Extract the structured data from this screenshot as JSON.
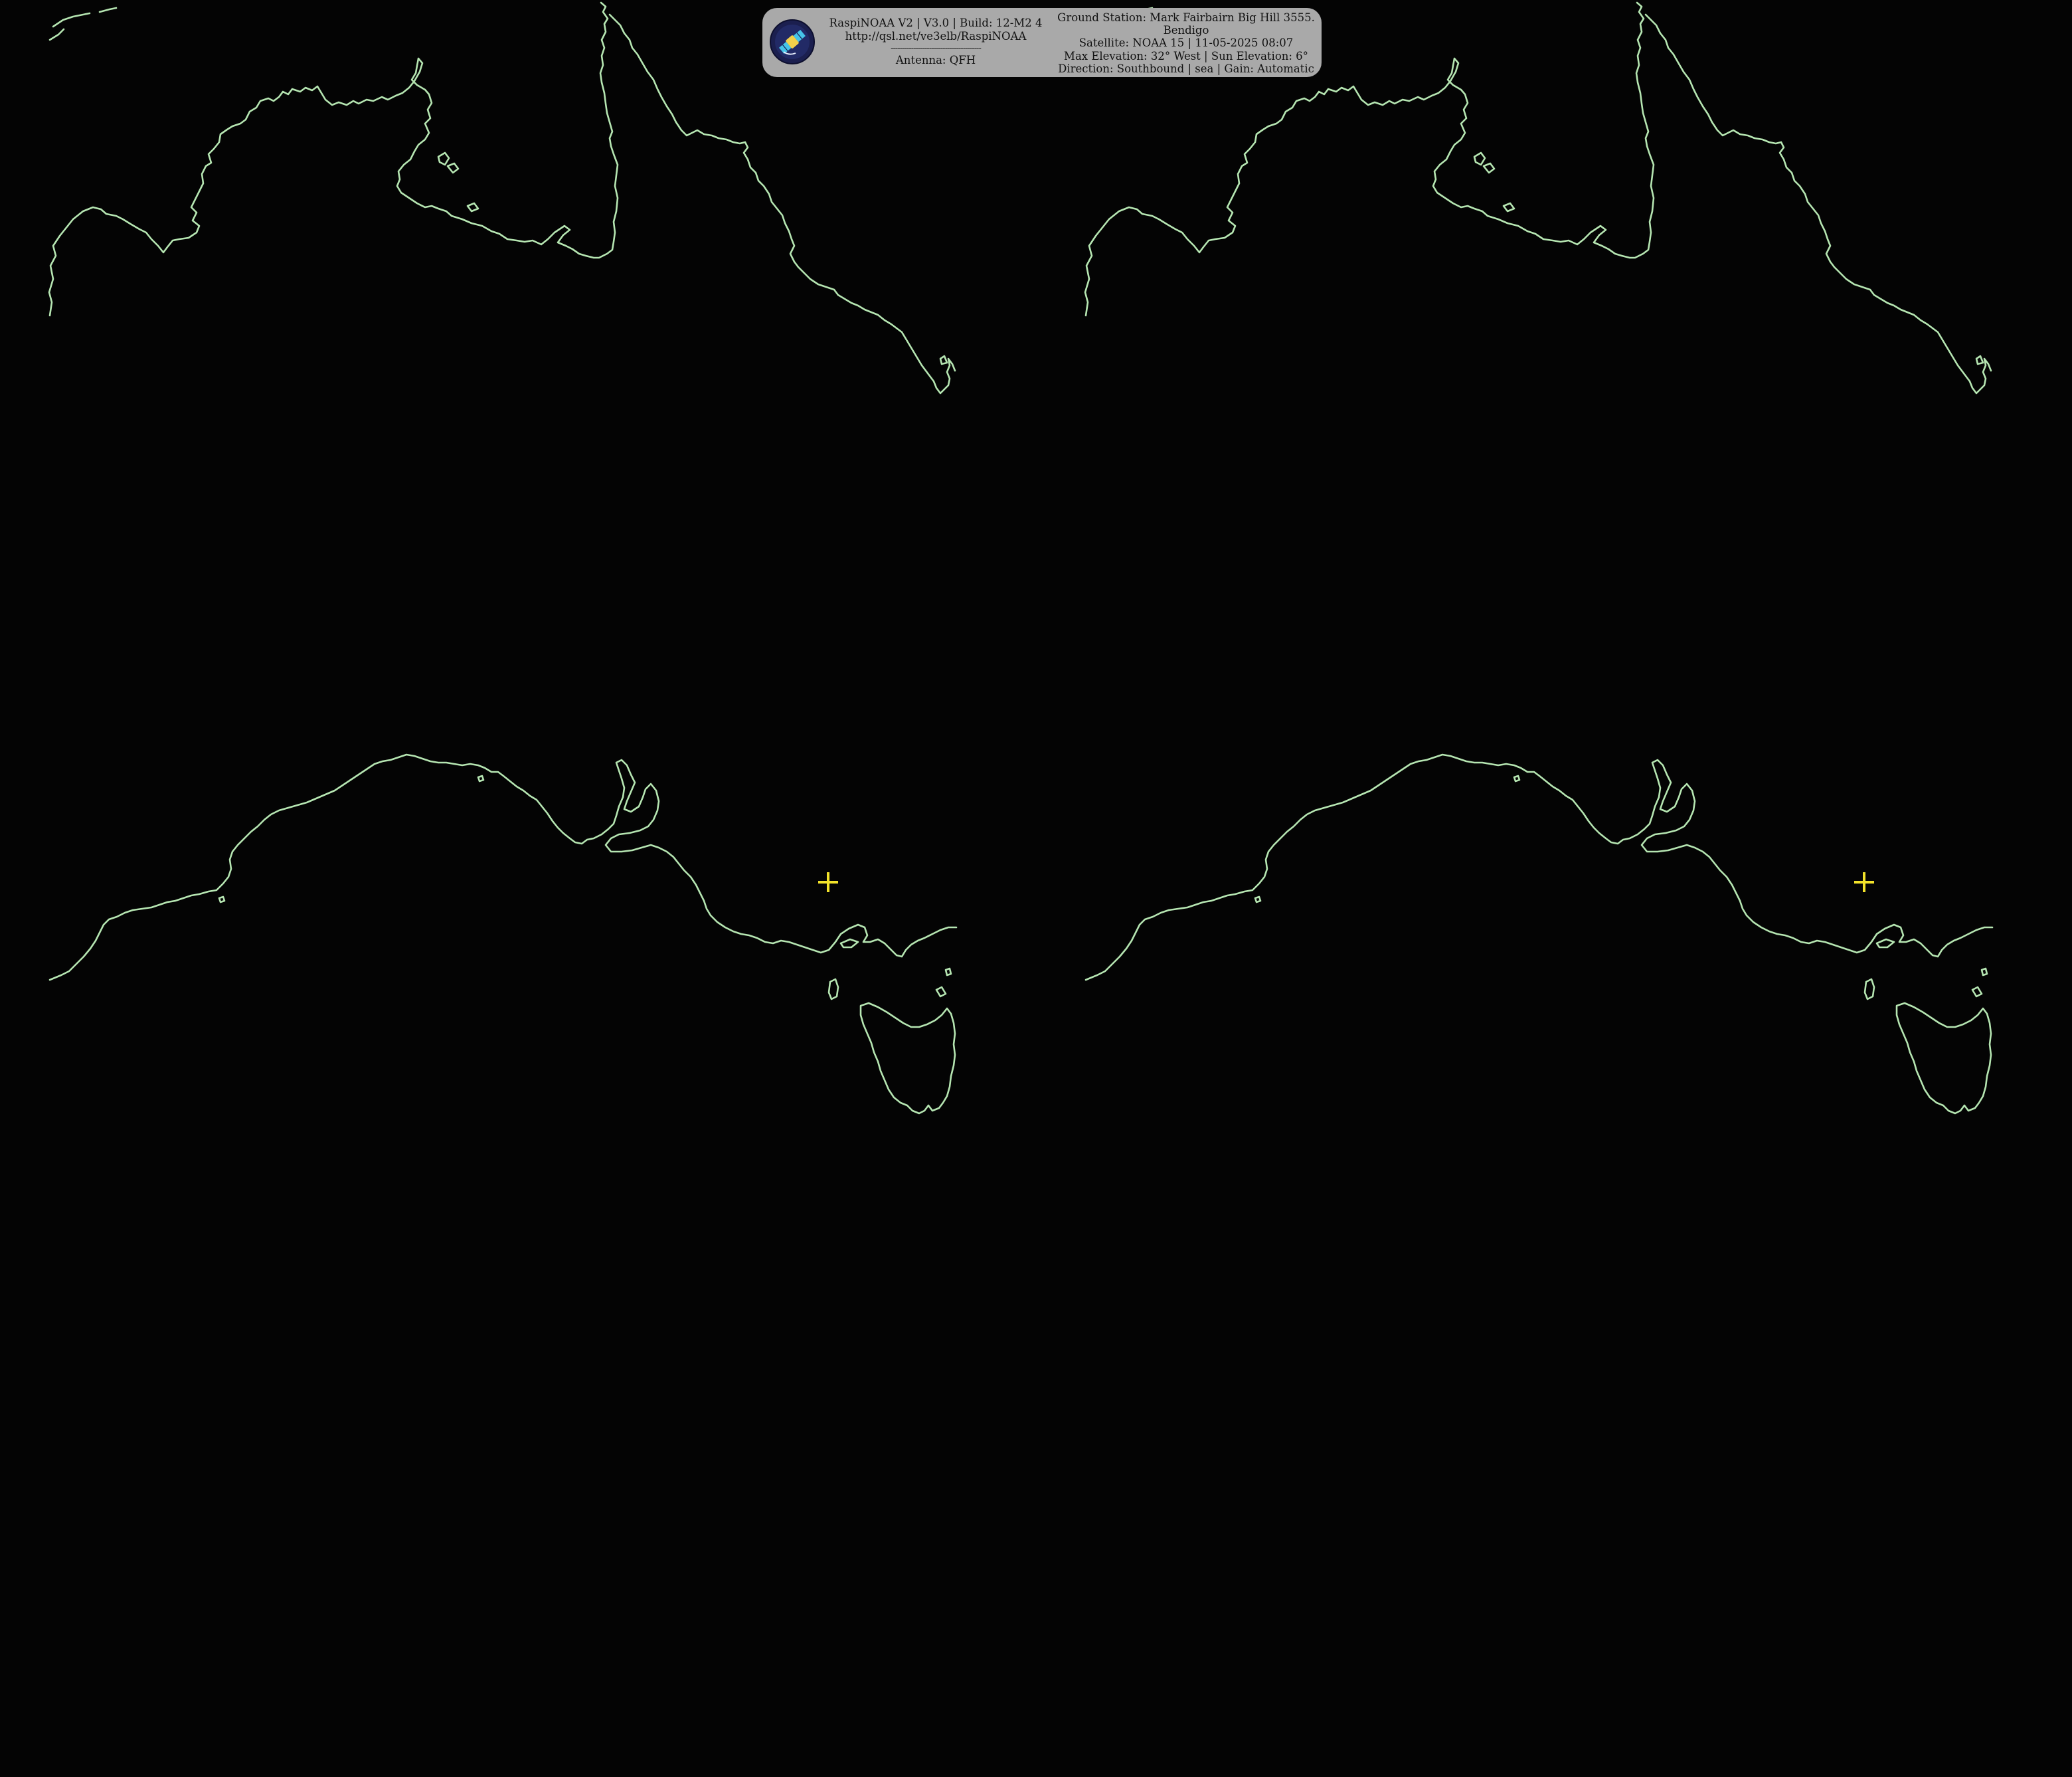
{
  "banner": {
    "left_lines": [
      "RaspiNOAA V2 | V3.0 | Build: 12-M2 4",
      "http://qsl.net/ve3elb/RaspiNOAA",
      "----------------------------------------",
      "Antenna: QFH"
    ],
    "right_lines": [
      "Ground Station: Mark Fairbairn Big Hill 3555.",
      "Bendigo",
      "Satellite: NOAA 15 | 11-05-2025 08:07",
      "Max Elevation: 32° West | Sun Elevation: 6°",
      "Direction: Southbound | sea | Gain: Automatic"
    ]
  },
  "map": {
    "background_color": "#040404",
    "coastline_color": "#b6e6b2",
    "marker_color": "#f2e22a",
    "marker_icon": "crosshair-icon",
    "logo_icon": "satellite-icon",
    "panels": [
      "panel-top-left",
      "panel-top-right",
      "panel-bottom-left",
      "panel-bottom-right"
    ]
  }
}
